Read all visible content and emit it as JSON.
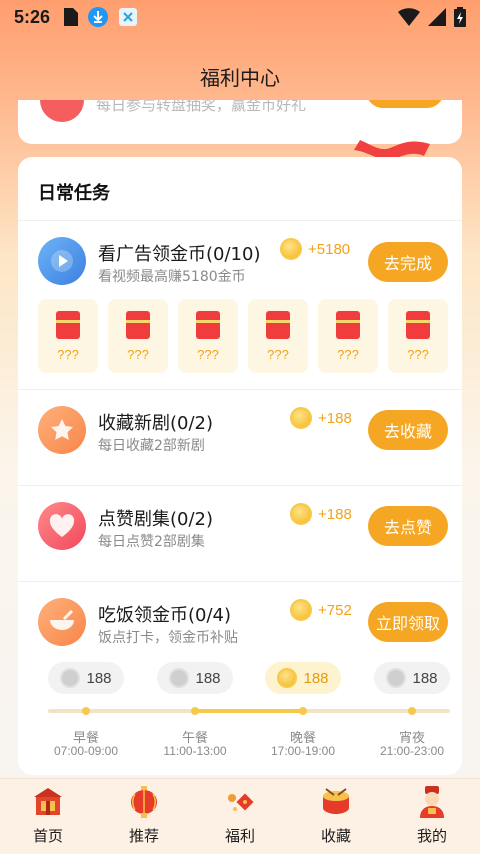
{
  "status_bar": {
    "time": "5:26"
  },
  "header": {
    "title": "福利中心"
  },
  "top_card": {
    "text": "每日参与转盘抽奖，赢金币好礼"
  },
  "daily_tasks": {
    "title": "日常任务",
    "items": [
      {
        "title": "看广告领金币(0/10)",
        "desc": "看视频最高赚5180金币",
        "reward": "+5180",
        "button": "去完成",
        "icon": "play-icon",
        "color": "#4a90e2"
      },
      {
        "title": "收藏新剧(0/2)",
        "desc": "每日收藏2部新剧",
        "reward": "+188",
        "button": "去收藏",
        "icon": "star-icon",
        "color": "#f7864a"
      },
      {
        "title": "点赞剧集(0/2)",
        "desc": "每日点赞2部剧集",
        "reward": "+188",
        "button": "去点赞",
        "icon": "heart-icon",
        "color": "#f45a6a"
      },
      {
        "title": "吃饭领金币(0/4)",
        "desc": "饭点打卡，领金币补贴",
        "reward": "+752",
        "button": "立即领取",
        "icon": "bowl-icon",
        "color": "#f7864a"
      }
    ],
    "packets": [
      "???",
      "???",
      "???",
      "???",
      "???",
      "???"
    ]
  },
  "meals": [
    {
      "amount": "188",
      "name": "早餐",
      "time": "07:00-09:00",
      "active": false
    },
    {
      "amount": "188",
      "name": "午餐",
      "time": "11:00-13:00",
      "active": false
    },
    {
      "amount": "188",
      "name": "晚餐",
      "time": "17:00-19:00",
      "active": true
    },
    {
      "amount": "188",
      "name": "宵夜",
      "time": "21:00-23:00",
      "active": false
    }
  ],
  "tabs": [
    {
      "label": "首页",
      "icon": "home-icon"
    },
    {
      "label": "推荐",
      "icon": "lantern-icon"
    },
    {
      "label": "福利",
      "icon": "gift-icon"
    },
    {
      "label": "收藏",
      "icon": "drum-icon"
    },
    {
      "label": "我的",
      "icon": "fortune-god-icon"
    }
  ],
  "colors": {
    "accent": "#f5a623",
    "coin": "#f5b51c"
  }
}
